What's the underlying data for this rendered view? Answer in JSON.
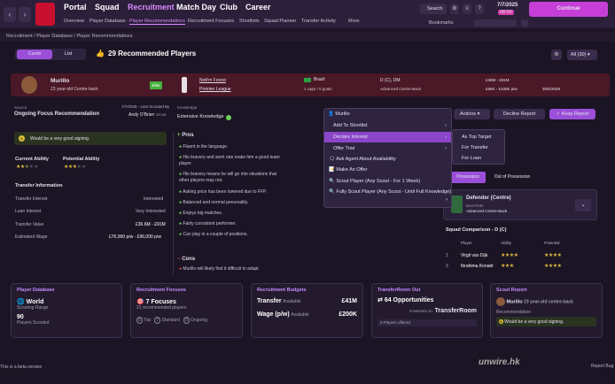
{
  "nav": {
    "items": [
      "Portal",
      "Squad",
      "Recruitment",
      "Match Day",
      "Club",
      "Career"
    ],
    "search": "Search",
    "date": "7/7/2025",
    "time": "08:00",
    "continue": "Continue",
    "bookmarks": "Bookmarks"
  },
  "subnav": [
    "Overview",
    "Player Database",
    "Player Recommendations",
    "Recruitment Focuses",
    "Shortlists",
    "Squad Planner",
    "Transfer Activity",
    "More"
  ],
  "breadcrumb": "Recruitment  /  Player Database  /  Player Recommendations",
  "toolbar": {
    "cards": "Cards",
    "list": "List",
    "title": "29 Recommended Players",
    "filter": "All (30)"
  },
  "player": {
    "name": "Murillo",
    "desc": "23 year-old Centre-back",
    "ability_badge": "Elite",
    "club": "Nott'm Forest",
    "league": "Premier League",
    "nation": "Brazil",
    "caps": "1 caps / 0 goals",
    "positions": "D (C), DM",
    "role": "Advanced Centre-Back",
    "value": "£36M - £91M",
    "wage": "£95K - £100K p/w",
    "contract": "30/6/2029"
  },
  "focus": {
    "source_label": "Source",
    "source": "Ongoing Focus Recommendation",
    "date": "7/7/2025 - Last Scouted By",
    "scout": "Andy O'Brien",
    "scout_role": "Scout",
    "knowledge_label": "Knowledge",
    "knowledge": "Extensive Knowledge"
  },
  "summary": "Would be a very good signing.",
  "ability": {
    "current_label": "Current Ability",
    "potential_label": "Potential Ability"
  },
  "transfer": {
    "title": "Transfer Information",
    "rows": [
      [
        "Transfer Interest",
        "Interested"
      ],
      [
        "Loan Interest",
        "Very Interested"
      ],
      [
        "Transfer Value",
        "£36.6M - £91M"
      ],
      [
        "Estimated Wage",
        "£76,000 p/w - £96,000 p/w"
      ]
    ]
  },
  "pros": {
    "title": "Pros",
    "items": [
      "Fluent in the language.",
      "His bravery and work rate make him a good team player.",
      "His bravery means he will go into situations that other players may not.",
      "Asking price has been lowered due to FFP.",
      "Balanced and normal personality.",
      "Enjoys big matches.",
      "Fairly consistent performer.",
      "Can play in a couple of positions."
    ]
  },
  "cons": {
    "title": "Cons",
    "items": [
      "Murillo will likely find it difficult to adapt"
    ]
  },
  "actions": {
    "actions": "Actions",
    "decline": "Decline Report",
    "keep": "Keep Report"
  },
  "context_menu": {
    "header": "Murillo",
    "items": [
      "Add To Shortlist",
      "Declare Interest",
      "Offer Trial",
      "Ask Agent About Availability",
      "Make An Offer",
      "Scout Player (Any Scout - For 1 Week)",
      "Fully Scout Player (Any Scout - Until Full Knowledge)"
    ],
    "submenu": [
      "As Top Target",
      "For Transfer",
      "For Loan"
    ]
  },
  "tactic": {
    "tab1": "Possession",
    "tab2": "Out of Possession",
    "position": "Defender (Centre)",
    "best": "Best Role",
    "role": "Advanced Centre-Back"
  },
  "squad": {
    "title": "Squad Comparison - D (C)",
    "cols": [
      "Player",
      "Ability",
      "Potential"
    ],
    "rows": [
      [
        "1",
        "Virgil van Dijk"
      ],
      [
        "2",
        "Ibrahima Konaté"
      ]
    ]
  },
  "bottom": {
    "db": {
      "title": "Player Database",
      "scope": "World",
      "scope_sub": "Scouting Range",
      "count": "90",
      "count_sub": "Players Scouted"
    },
    "focuses": {
      "title": "Recruitment Focuses",
      "count": "7 Focuses",
      "sub": "21 recommended players",
      "legend": [
        "Top",
        "Standard",
        "Ongoing"
      ],
      "legend_counts": [
        "0",
        "7",
        "0"
      ]
    },
    "budgets": {
      "title": "Recruitment Budgets",
      "transfer": "Transfer",
      "transfer_status": "Available",
      "transfer_val": "£41M",
      "wage": "Wage (p/w)",
      "wage_status": "Available",
      "wage_val": "£200K"
    },
    "tr": {
      "title": "TransferRoom Out",
      "count": "64 Opportunities",
      "powered": "POWERED BY",
      "brand": "TransferRoom",
      "offered": "0 Players offered"
    },
    "report": {
      "title": "Scout Report",
      "name": "Murillo",
      "desc": "23 year-old centre-back",
      "rec_label": "Recommendation",
      "rec": "Would be a very good signing."
    }
  },
  "footer": {
    "beta": "This is a beta version",
    "bug": "Report Bug",
    "watermark": "unwire.hk"
  }
}
